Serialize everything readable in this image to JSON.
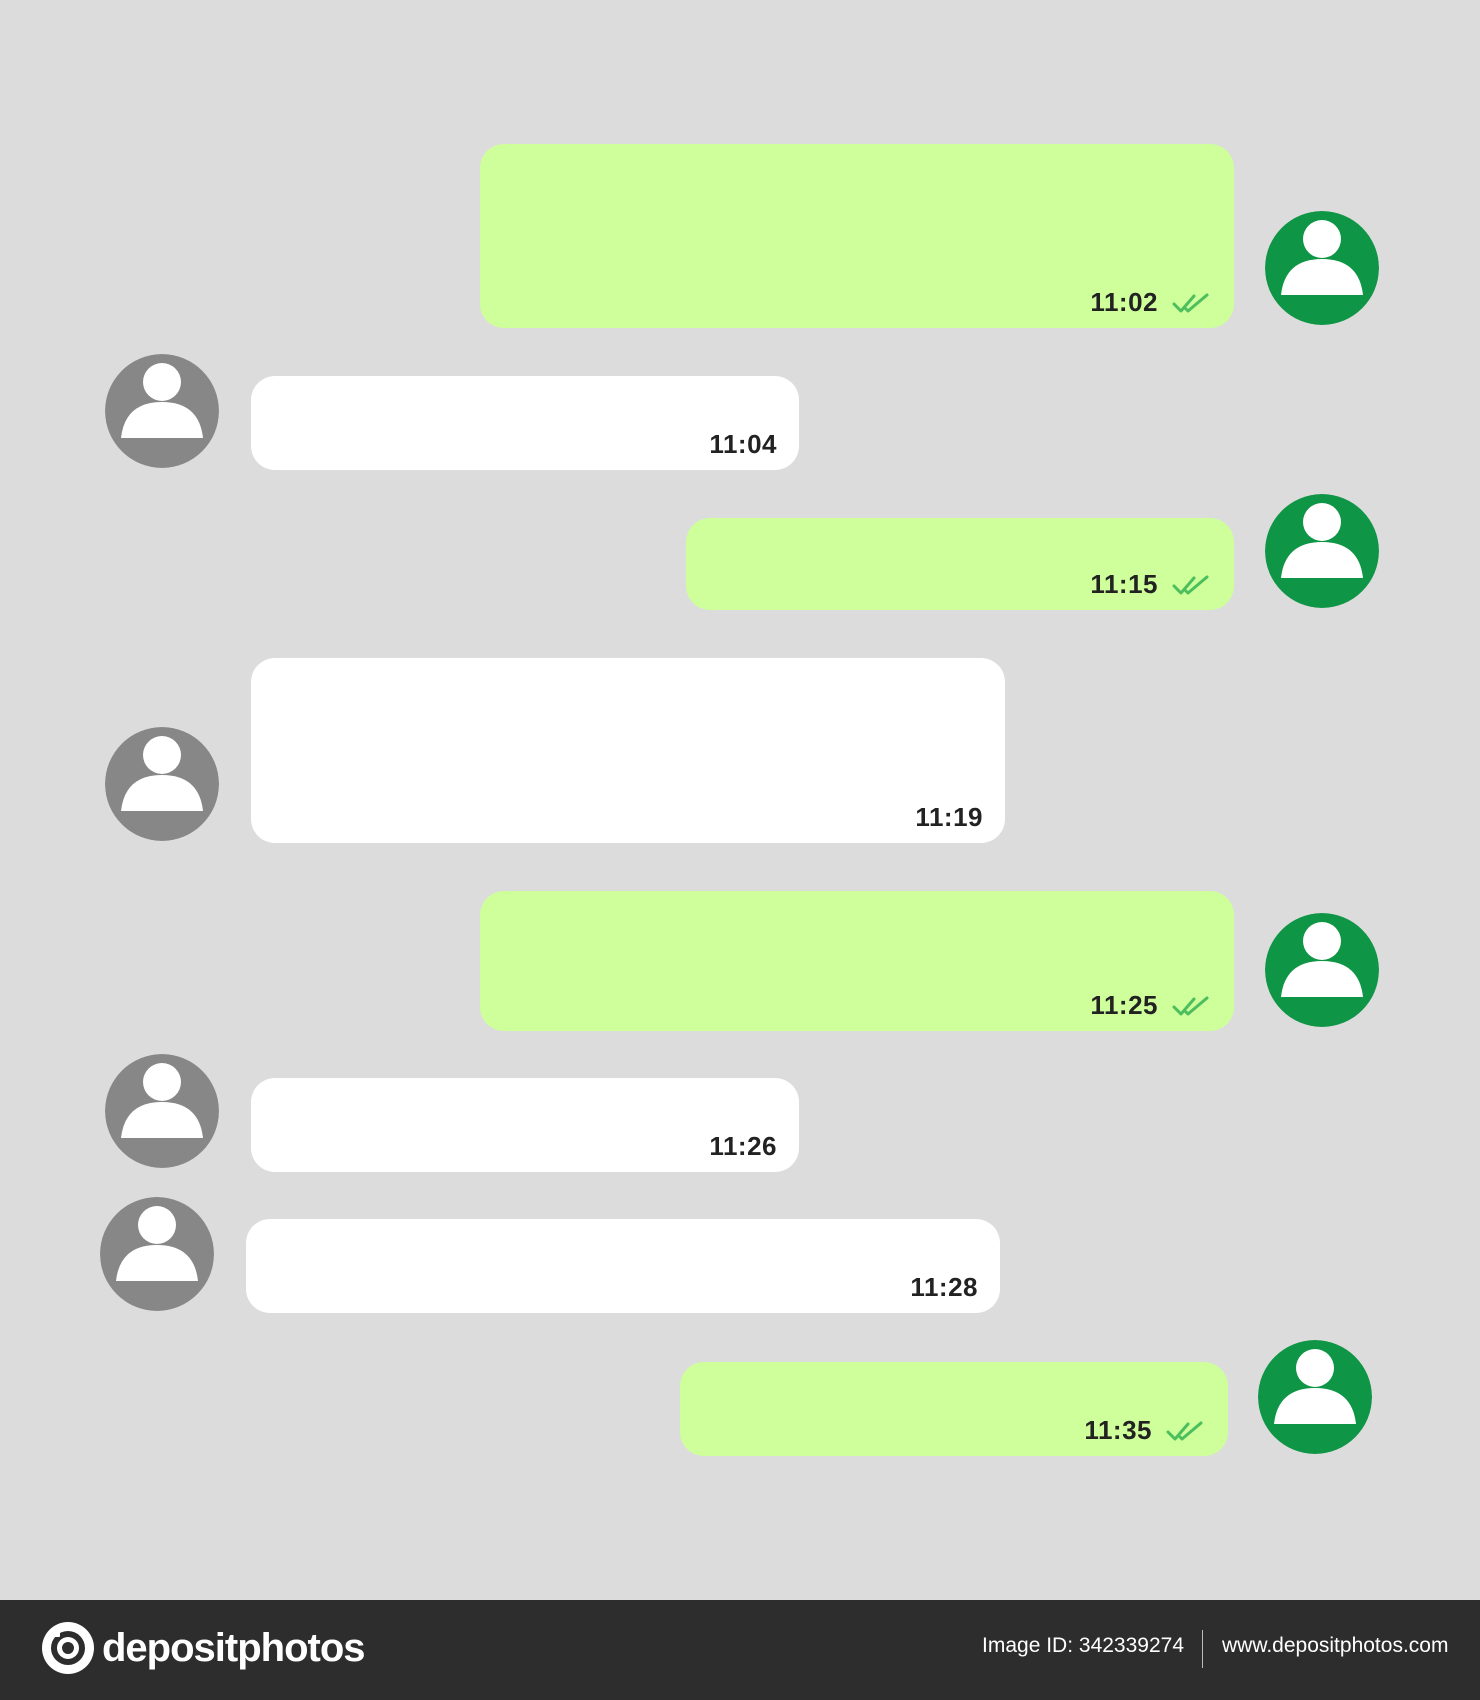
{
  "colors": {
    "background": "#dcdcdc",
    "outgoing_bubble": "#ceff9a",
    "incoming_bubble": "#ffffff",
    "outgoing_avatar": "#0f9546",
    "incoming_avatar": "#878787",
    "read_ticks": "#4cbf5c",
    "footer": "#2d2d2d"
  },
  "messages": [
    {
      "direction": "outgoing",
      "time": "11:02",
      "status_icon": "double-check-icon"
    },
    {
      "direction": "incoming",
      "time": "11:04"
    },
    {
      "direction": "outgoing",
      "time": "11:15",
      "status_icon": "double-check-icon"
    },
    {
      "direction": "incoming",
      "time": "11:19"
    },
    {
      "direction": "outgoing",
      "time": "11:25",
      "status_icon": "double-check-icon"
    },
    {
      "direction": "incoming",
      "time": "11:26"
    },
    {
      "direction": "incoming",
      "time": "11:28"
    },
    {
      "direction": "outgoing",
      "time": "11:35",
      "status_icon": "double-check-icon"
    }
  ],
  "footer": {
    "brand": "depositphotos",
    "brand_icon": "camera-icon",
    "image_id": "Image ID: 342339274",
    "site": "www.depositphotos.com"
  }
}
